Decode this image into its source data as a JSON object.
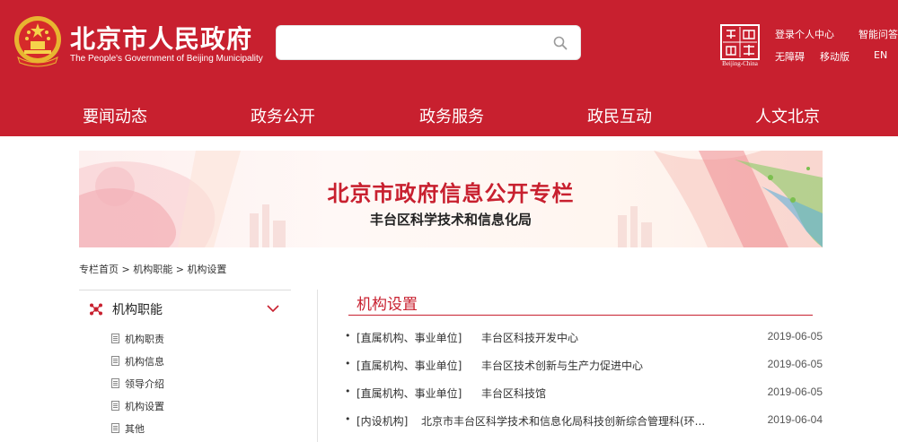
{
  "header": {
    "site_title": "北京市人民政府",
    "site_subtitle": "The People's Government of Beijing Municipality",
    "search_placeholder": "",
    "seal_caption": "Beijing-China",
    "util_links": {
      "login": "登录个人中心",
      "qa": "智能问答",
      "accessible": "无障碍",
      "mobile": "移动版",
      "lang": "EN"
    },
    "brand_color": "#c8202f"
  },
  "nav": {
    "items": [
      {
        "label": "要闻动态"
      },
      {
        "label": "政务公开"
      },
      {
        "label": "政务服务"
      },
      {
        "label": "政民互动"
      },
      {
        "label": "人文北京"
      }
    ]
  },
  "banner": {
    "title": "北京市政府信息公开专栏",
    "subtitle": "丰台区科学技术和信息化局"
  },
  "breadcrumb": {
    "items": [
      "专栏首页",
      "机构职能",
      "机构设置"
    ],
    "separator": ">"
  },
  "sidebar": {
    "heading": "机构职能",
    "items": [
      {
        "label": "机构职责"
      },
      {
        "label": "机构信息"
      },
      {
        "label": "领导介绍"
      },
      {
        "label": "机构设置"
      },
      {
        "label": "其他"
      }
    ]
  },
  "main": {
    "section_title": "机构设置",
    "list": [
      {
        "category": "[直属机构、事业单位]",
        "title": "丰台区科技开发中心",
        "date": "2019-06-05"
      },
      {
        "category": "[直属机构、事业单位]",
        "title": "丰台区技术创新与生产力促进中心",
        "date": "2019-06-05"
      },
      {
        "category": "[直属机构、事业单位]",
        "title": "丰台区科技馆",
        "date": "2019-06-05"
      },
      {
        "category": "[内设机构]",
        "title": "北京市丰台区科学技术和信息化局科技创新综合管理科(环...",
        "date": "2019-06-04"
      }
    ]
  }
}
